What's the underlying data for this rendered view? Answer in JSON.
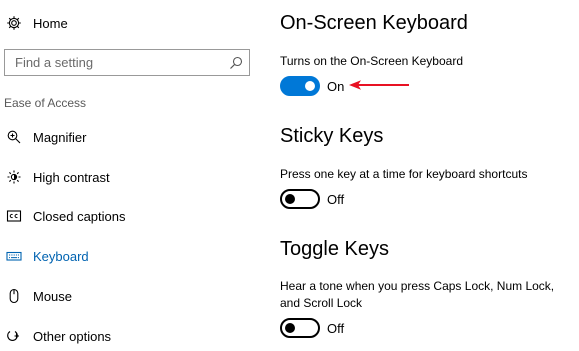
{
  "sidebar": {
    "home_label": "Home",
    "search_placeholder": "Find a setting",
    "section_heading": "Ease of Access",
    "items": [
      {
        "label": "Magnifier",
        "icon": "magnifier-icon"
      },
      {
        "label": "High contrast",
        "icon": "high-contrast-icon"
      },
      {
        "label": "Closed captions",
        "icon": "closed-captions-icon"
      },
      {
        "label": "Keyboard",
        "icon": "keyboard-icon",
        "selected": true
      },
      {
        "label": "Mouse",
        "icon": "mouse-icon"
      },
      {
        "label": "Other options",
        "icon": "other-options-icon"
      }
    ]
  },
  "main": {
    "sections": [
      {
        "title": "On-Screen Keyboard",
        "description": "Turns on the On-Screen Keyboard",
        "state": "On",
        "on": true
      },
      {
        "title": "Sticky Keys",
        "description": "Press one key at a time for keyboard shortcuts",
        "state": "Off",
        "on": false
      },
      {
        "title": "Toggle Keys",
        "description": "Hear a tone when you press Caps Lock, Num Lock, and Scroll Lock",
        "state": "Off",
        "on": false
      }
    ]
  },
  "colors": {
    "accent": "#0078d7",
    "selected_text": "#0063b1",
    "annotation_arrow": "#e81123"
  }
}
